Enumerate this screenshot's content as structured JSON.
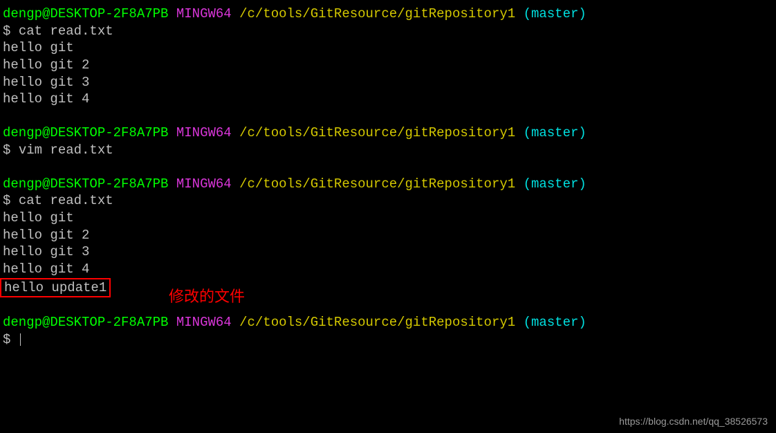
{
  "prompt": {
    "user_host": "dengp@DESKTOP-2F8A7PB",
    "env": "MINGW64",
    "path": "/c/tools/GitResource/gitRepository1",
    "branch": "(master)",
    "prompt_symbol": "$"
  },
  "blocks": [
    {
      "command": "cat read.txt",
      "output": [
        "hello git",
        "hello git 2",
        "hello git 3",
        "hello git 4"
      ]
    },
    {
      "command": "vim read.txt",
      "output": []
    },
    {
      "command": "cat read.txt",
      "output": [
        "hello git",
        "hello git 2",
        "hello git 3",
        "hello git 4",
        "hello update1"
      ],
      "highlight_last": true
    }
  ],
  "annotation": "修改的文件",
  "final_prompt_symbol": "$",
  "watermark": "https://blog.csdn.net/qq_38526573"
}
